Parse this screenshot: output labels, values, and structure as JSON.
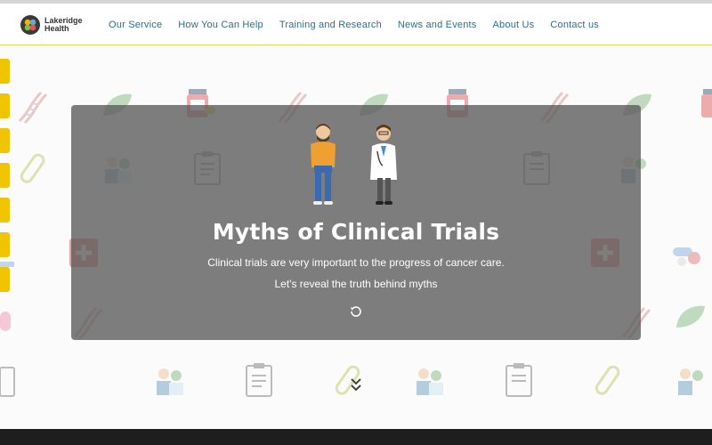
{
  "brand": {
    "name_line1": "Lakeridge",
    "name_line2": "Health"
  },
  "nav": {
    "items": [
      {
        "label": "Our Service"
      },
      {
        "label": "How You Can Help"
      },
      {
        "label": "Training and Research"
      },
      {
        "label": "News and Events"
      },
      {
        "label": "About Us"
      },
      {
        "label": "Contact us"
      }
    ]
  },
  "hero": {
    "title": "Myths of Clinical Trials",
    "subtitle_line1": "Clinical trials are very important to the progress of cancer care.",
    "subtitle_line2": "Let's reveal the truth behind myths",
    "replay_icon": "replay-icon"
  },
  "scroll": {
    "icon": "double-chevron-down-icon"
  },
  "colors": {
    "accent": "#f0c400",
    "nav_link": "#2a6f8f",
    "hero_overlay": "#5a5a5a",
    "footer": "#1e1e1e"
  }
}
